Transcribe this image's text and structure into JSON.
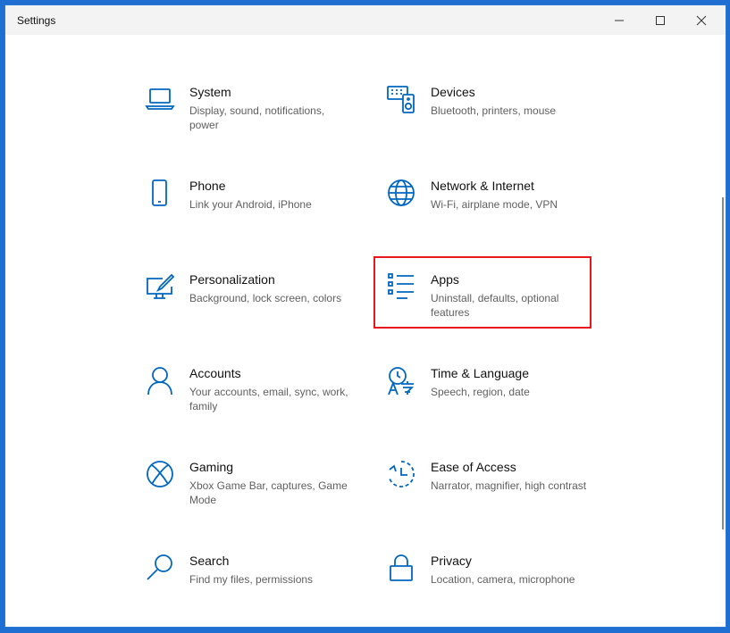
{
  "window": {
    "title": "Settings",
    "minimize_icon": "minimize-icon",
    "maximize_icon": "maximize-icon",
    "close_icon": "close-icon"
  },
  "tiles": [
    {
      "id": "system",
      "name": "System",
      "desc": "Display, sound, notifications, power",
      "icon": "laptop-icon"
    },
    {
      "id": "devices",
      "name": "Devices",
      "desc": "Bluetooth, printers, mouse",
      "icon": "keyboard-speaker-icon"
    },
    {
      "id": "phone",
      "name": "Phone",
      "desc": "Link your Android, iPhone",
      "icon": "phone-icon"
    },
    {
      "id": "network",
      "name": "Network & Internet",
      "desc": "Wi-Fi, airplane mode, VPN",
      "icon": "globe-icon"
    },
    {
      "id": "personalization",
      "name": "Personalization",
      "desc": "Background, lock screen, colors",
      "icon": "paint-monitor-icon"
    },
    {
      "id": "apps",
      "name": "Apps",
      "desc": "Uninstall, defaults, optional features",
      "icon": "apps-list-icon"
    },
    {
      "id": "accounts",
      "name": "Accounts",
      "desc": "Your accounts, email, sync, work, family",
      "icon": "person-icon"
    },
    {
      "id": "time",
      "name": "Time & Language",
      "desc": "Speech, region, date",
      "icon": "time-language-icon"
    },
    {
      "id": "gaming",
      "name": "Gaming",
      "desc": "Xbox Game Bar, captures, Game Mode",
      "icon": "xbox-icon"
    },
    {
      "id": "ease",
      "name": "Ease of Access",
      "desc": "Narrator, magnifier, high contrast",
      "icon": "ease-of-access-icon"
    },
    {
      "id": "search",
      "name": "Search",
      "desc": "Find my files, permissions",
      "icon": "magnifier-icon"
    },
    {
      "id": "privacy",
      "name": "Privacy",
      "desc": "Location, camera, microphone",
      "icon": "lock-icon"
    }
  ],
  "colors": {
    "accent": "#0067c0",
    "highlight": "#e8161e"
  }
}
